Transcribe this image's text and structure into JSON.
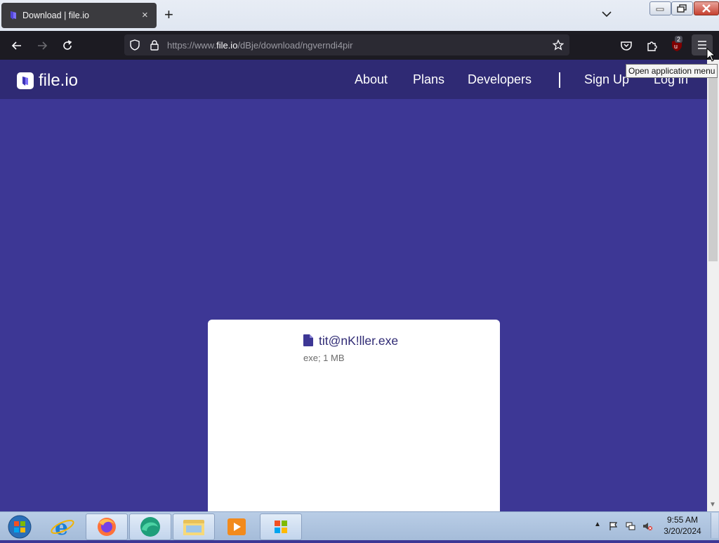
{
  "browser": {
    "tab": {
      "title": "Download | file.io",
      "close": "×"
    },
    "new_tab": "+",
    "url": {
      "prefix": "https://www.",
      "host": "file.io",
      "path": "/dBje/download/ngverndi4pir"
    },
    "extension_badge": "2",
    "tooltip": "Open application menu"
  },
  "site": {
    "logo_text": "file.io",
    "nav": [
      "About",
      "Plans",
      "Developers",
      "Sign Up",
      "Log in"
    ]
  },
  "file": {
    "name": "tit@nK!ller.exe",
    "meta": "exe; 1 MB"
  },
  "taskbar": {
    "time": "9:55 AM",
    "date": "3/20/2024"
  },
  "colors": {
    "page_bg": "#3d3795",
    "header_bg": "#2f2a74",
    "accent": "#2f2a74"
  }
}
